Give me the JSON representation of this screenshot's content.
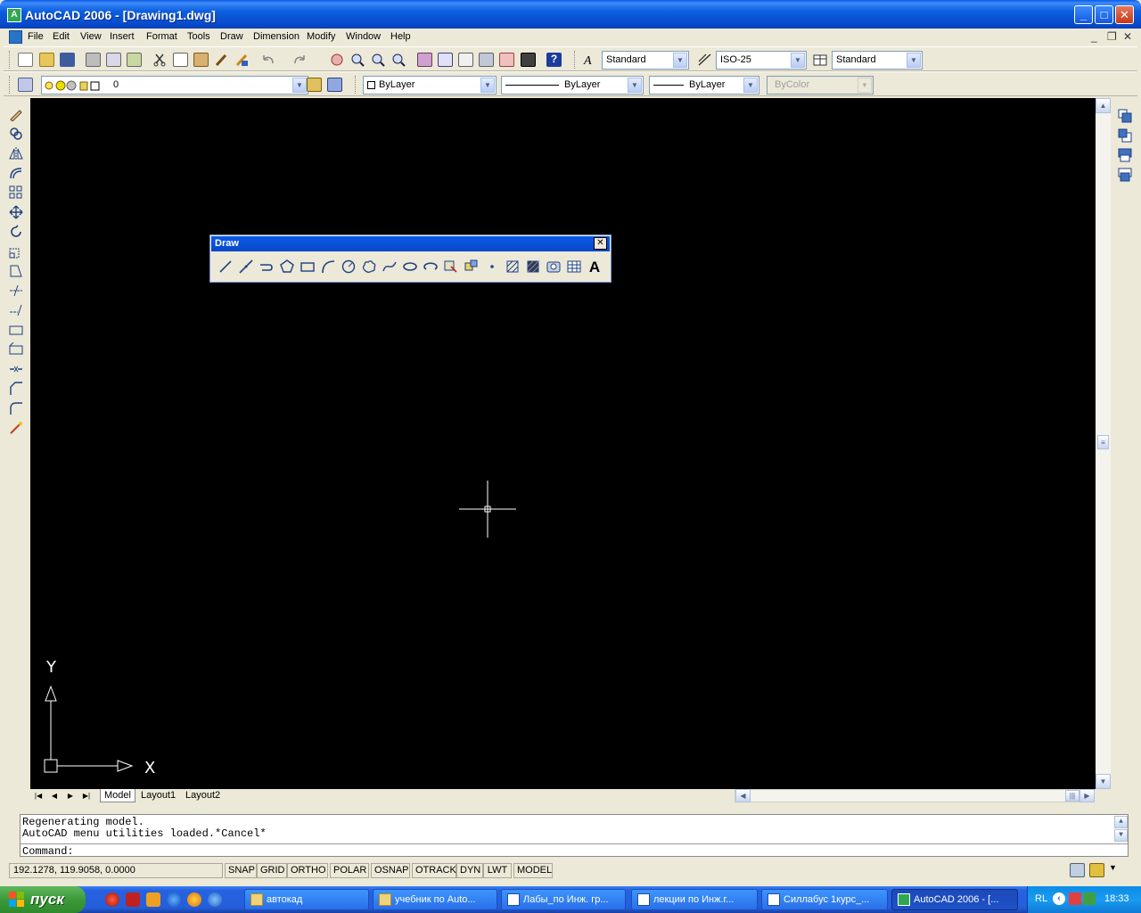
{
  "window": {
    "title": "AutoCAD 2006 - [Drawing1.dwg]",
    "minimize": "_",
    "maximize": "□",
    "close": "✕"
  },
  "menu": {
    "items": [
      "File",
      "Edit",
      "View",
      "Insert",
      "Format",
      "Tools",
      "Draw",
      "Dimension",
      "Modify",
      "Window",
      "Help"
    ],
    "mdi_minimize": "_",
    "mdi_restore": "❐",
    "mdi_close": "✕"
  },
  "styles_toolbar": {
    "text_style": "Standard",
    "dim_style": "ISO-25",
    "table_style": "Standard"
  },
  "layers_toolbar": {
    "current_layer": "0"
  },
  "properties_toolbar": {
    "color": "ByLayer",
    "linetype": "ByLayer",
    "lineweight": "ByLayer",
    "plotstyle": "ByColor"
  },
  "draw_toolbar": {
    "title": "Draw",
    "close": "✕",
    "text_tool": "A"
  },
  "ucs": {
    "x_label": "X",
    "y_label": "Y"
  },
  "tabs": {
    "items": [
      "Model",
      "Layout1",
      "Layout2"
    ],
    "active": "Model"
  },
  "command": {
    "lines": [
      "Regenerating model.",
      "AutoCAD menu utilities loaded.*Cancel*"
    ],
    "prompt": "Command:"
  },
  "status": {
    "coords": "192.1278, 119.9058, 0.0000",
    "buttons": [
      "SNAP",
      "GRID",
      "ORTHO",
      "POLAR",
      "OSNAP",
      "OTRACK",
      "DYN",
      "LWT",
      "MODEL"
    ]
  },
  "taskbar": {
    "start": "пуск",
    "tasks": [
      "автокад",
      "учебник по Auto...",
      "Лабы_по Инж. гр...",
      "лекции по Инж.г...",
      "Силлабус 1курс_...",
      "AutoCAD 2006 - [..."
    ],
    "active_task": "AutoCAD 2006 - [...",
    "lang": "RL",
    "time": "18:33"
  },
  "colors": {
    "canvas": "#000000",
    "title_blue": "#0a5ae8",
    "face": "#ece9d8"
  }
}
